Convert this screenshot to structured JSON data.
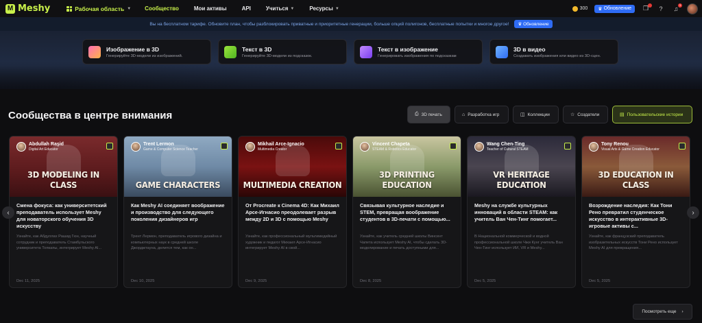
{
  "nav": {
    "logo_text": "Meshy",
    "workspace_label": "Рабочая область",
    "links": [
      {
        "label": "Сообщество",
        "active": true,
        "dropdown": false
      },
      {
        "label": "Мои активы",
        "active": false,
        "dropdown": false
      },
      {
        "label": "API",
        "active": false,
        "dropdown": false
      },
      {
        "label": "Учиться",
        "active": false,
        "dropdown": true
      },
      {
        "label": "Ресурсы",
        "active": false,
        "dropdown": true
      }
    ],
    "credits": "300",
    "upgrade_label": "Обновление",
    "notification_count": "3"
  },
  "banner": {
    "text": "Вы на бесплатном тарифе. Обновите план, чтобы разблокировать приватные и приоритетные генерации, больше опций полигонов, бесплатные попытки и многое другое!",
    "button_label": "Обновление"
  },
  "tools": [
    {
      "title": "Изображение в 3D",
      "subtitle": "Генерируйте 3D-модели из изображений."
    },
    {
      "title": "Текст в 3D",
      "subtitle": "Генерируйте 3D-модели из подсказок."
    },
    {
      "title": "Текст в изображение",
      "subtitle": "Генерировать изображения по подсказкам"
    },
    {
      "title": "3D в видео",
      "subtitle": "Создавать изображения или видео из 3D-сцен."
    }
  ],
  "section": {
    "title": "Сообщества в центре внимания",
    "filters": [
      "3D печать",
      "Разработка игр",
      "Коллекции",
      "Создатели",
      "Пользовательские истории"
    ]
  },
  "cards": [
    {
      "author": "Abdullah Raşid",
      "role": "Digital Art Educator",
      "image_title": "3D MODELING IN CLASS",
      "title": "Смена фокуса: как университетский преподаватель использует Meshy для новаторского обучения 3D искусству",
      "desc": "Узнайте, как Абдуллах Рашид Гюн, научный сотрудник и преподаватель Стамбульского университета Топкапы, интегрирует Meshy AI...",
      "date": "Dec 11, 2025"
    },
    {
      "author": "Trent Lermon",
      "role": "Game & Computer Science Teacher",
      "image_title": "GAME CHARACTERS",
      "title": "Как Meshy AI соединяет воображение и производство для следующего поколения дизайнеров игр",
      "desc": "Трент Лермон, преподаватель игрового дизайна и компьютерных наук в средней школе Джорджтауна, делится тем, как он...",
      "date": "Dec 10, 2025"
    },
    {
      "author": "Mikhail Arce-Ignacio",
      "role": "Multimedia Creator",
      "image_title": "MULTIMEDIA CREATION",
      "title": "От Procreate к Cinema 4D: Как Михаил Арсе-Игнасио преодолевает разрыв между 2D и 3D с помощью Meshy",
      "desc": "Узнайте, как профессиональный мультимедийный художник и педагог Михаил Арсе-Игнасио интегрирует Meshy AI в свой...",
      "date": "Dec 9, 2025"
    },
    {
      "author": "Vincent Chapeta",
      "role": "STEAM & Robotics Educator",
      "image_title": "3D PRINTING EDUCATION",
      "title": "Связывая культурное наследие и STEM, превращая воображение студентов в 3D-печати с помощью...",
      "desc": "Узнайте, как учитель средней школы Винсент Чапета использует Meshy AI, чтобы сделать 3D-моделирование и печать доступными для...",
      "date": "Dec 8, 2025"
    },
    {
      "author": "Wang Chen-Ting",
      "role": "Teacher of Cultural STEAM",
      "image_title": "VR HERITAGE EDUCATION",
      "title": "Meshy на службе культурных инноваций в области STEAM: как учитель Ван Чен-Тинг помогает...",
      "desc": "В Национальной коммерческой и водной профессиональной школе Чжи Кунг учитель Ван Чен-Тинг использует ИИ, VR и Meshy...",
      "date": "Dec 5, 2025"
    },
    {
      "author": "Tony Renou",
      "role": "Visual Arts & Game Creation Educator",
      "image_title": "3D EDUCATION IN CLASS",
      "title": "Возрождение наследия: Как Тони Рено превратил студенческое искусство в интерактивные 3D-игровые активы с...",
      "desc": "Узнайте, как французский преподаватель изобразительных искусств Тони Рено использует Meshy AI для превращения...",
      "date": "Dec 5, 2025"
    }
  ],
  "see_more_label": "Посмотреть еще",
  "colors": {
    "accent": "#c8f04a",
    "brand_blue": "#2f6cf5",
    "background": "#0e0e10"
  }
}
